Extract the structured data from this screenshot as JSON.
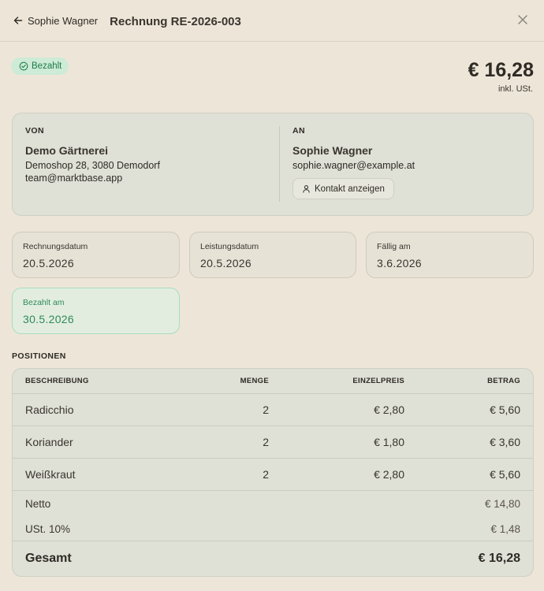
{
  "header": {
    "back_label": "Sophie Wagner",
    "title": "Rechnung RE-2026-003"
  },
  "status": {
    "badge": "Bezahlt",
    "total": "€ 16,28",
    "total_note": "inkl. USt."
  },
  "from": {
    "label": "VON",
    "name": "Demo Gärtnerei",
    "address": "Demoshop 28, 3080 Demodorf",
    "email": "team@marktbase.app"
  },
  "to": {
    "label": "AN",
    "name": "Sophie Wagner",
    "email": "sophie.wagner@example.at",
    "contact_button": "Kontakt anzeigen"
  },
  "dates": {
    "invoice_label": "Rechnungsdatum",
    "invoice_value": "20.5.2026",
    "service_label": "Leistungsdatum",
    "service_value": "20.5.2026",
    "due_label": "Fällig am",
    "due_value": "3.6.2026",
    "paid_label": "Bezahlt am",
    "paid_value": "30.5.2026"
  },
  "positions": {
    "section_label": "POSITIONEN",
    "columns": [
      "BESCHREIBUNG",
      "MENGE",
      "EINZELPREIS",
      "BETRAG"
    ],
    "rows": [
      {
        "desc": "Radicchio",
        "qty": "2",
        "unit": "€ 2,80",
        "amount": "€ 5,60"
      },
      {
        "desc": "Koriander",
        "qty": "2",
        "unit": "€ 1,80",
        "amount": "€ 3,60"
      },
      {
        "desc": "Weißkraut",
        "qty": "2",
        "unit": "€ 2,80",
        "amount": "€ 5,60"
      }
    ],
    "net_label": "Netto",
    "net_value": "€ 14,80",
    "tax_label": "USt. 10%",
    "tax_value": "€ 1,48",
    "total_label": "Gesamt",
    "total_value": "€ 16,28"
  },
  "colors": {
    "background": "#ede6d8",
    "card": "#dfe0d6",
    "paid_green": "#2f8a58",
    "badge_bg": "#cdebd6"
  },
  "icons": {
    "back": "arrow-left-icon",
    "close": "close-icon",
    "badge": "check-circle-icon",
    "contact": "user-icon"
  }
}
